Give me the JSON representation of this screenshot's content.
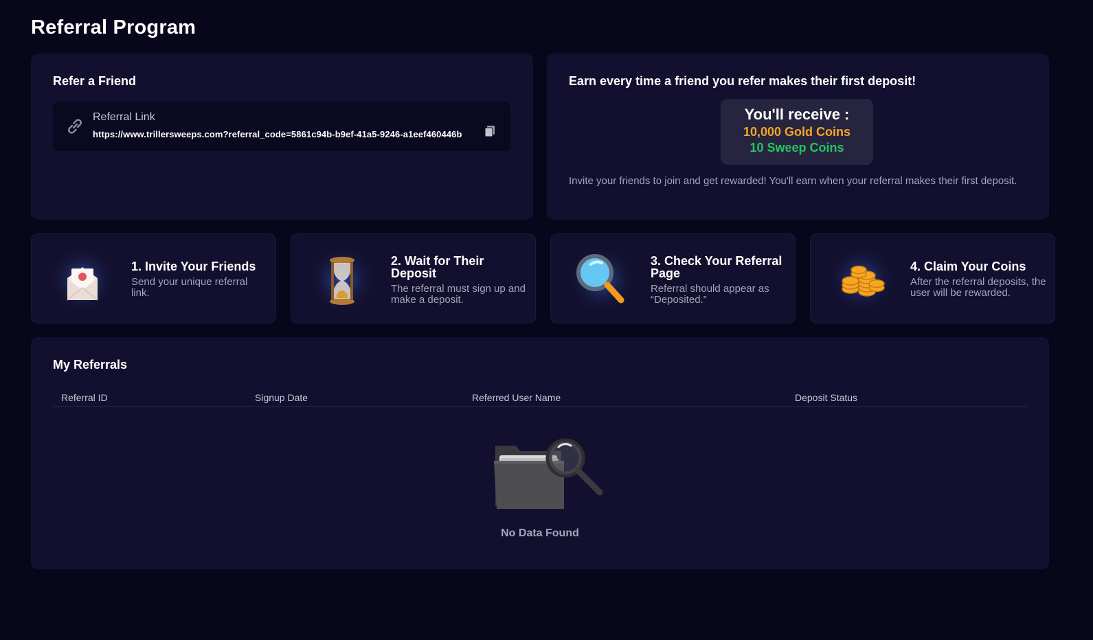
{
  "page": {
    "title": "Referral Program"
  },
  "refer": {
    "heading": "Refer a Friend",
    "link_label": "Referral Link",
    "link_url": "https://www.trillersweeps.com?referral_code=5861c94b-b9ef-41a5-9246-a1eef460446b",
    "link_icon": "link-icon",
    "copy_icon": "copy-icon"
  },
  "earn": {
    "heading": "Earn every time a friend you refer makes their first deposit!",
    "receive_title": "You'll receive :",
    "gold": "10,000 Gold Coins",
    "sweep": "10 Sweep Coins",
    "description": "Invite your friends to join and get rewarded! You'll earn when your referral makes their first deposit.",
    "colors": {
      "gold": "#f5a623",
      "sweep": "#22c55e"
    }
  },
  "steps": [
    {
      "title": "1. Invite Your Friends",
      "desc": "Send your unique referral link.",
      "icon": "envelope-icon"
    },
    {
      "title": "2. Wait for Their Deposit",
      "desc": "The referral must sign up and make a deposit.",
      "icon": "hourglass-icon"
    },
    {
      "title": "3. Check Your Referral Page",
      "desc": "Referral should appear as “Deposited.”",
      "icon": "magnifier-icon"
    },
    {
      "title": "4. Claim Your Coins",
      "desc": "After the referral deposits, the user will be rewarded.",
      "icon": "coins-icon"
    }
  ],
  "referrals": {
    "heading": "My Referrals",
    "columns": [
      "Referral ID",
      "Signup Date",
      "Referred User Name",
      "Deposit Status"
    ],
    "empty_text": "No Data Found",
    "empty_icon": "empty-folder-icon"
  }
}
